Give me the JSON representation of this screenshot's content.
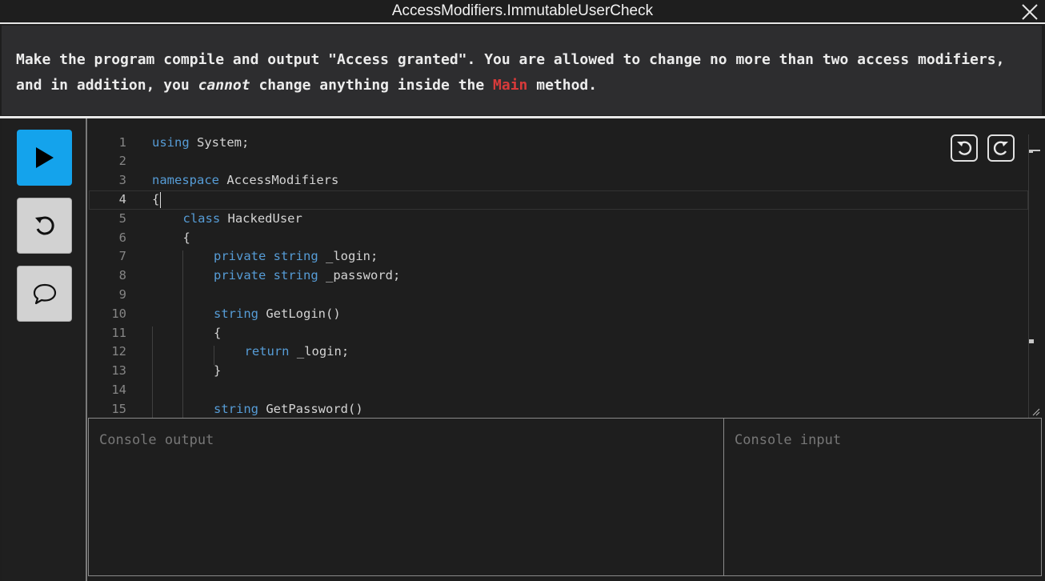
{
  "window": {
    "title": "AccessModifiers.ImmutableUserCheck"
  },
  "task": {
    "part1": "Make the program compile and output \"Access granted\". You are allowed to change no more than two access modifiers, and in addition, you ",
    "emphasis": "cannot",
    "part2": " change anything inside the ",
    "keyword": "Main",
    "part3": " method."
  },
  "sidebar": {
    "run_icon": "play-icon",
    "reset_icon": "reset-icon",
    "chat_icon": "chat-bubble-icon"
  },
  "editor": {
    "current_line": 4,
    "lines": [
      {
        "n": "1",
        "indent": 0,
        "tokens": [
          {
            "t": "using",
            "k": true
          },
          {
            "t": " System;"
          }
        ]
      },
      {
        "n": "2",
        "indent": 0,
        "tokens": []
      },
      {
        "n": "3",
        "indent": 0,
        "tokens": [
          {
            "t": "namespace",
            "k": true
          },
          {
            "t": " AccessModifiers"
          }
        ]
      },
      {
        "n": "4",
        "indent": 0,
        "tokens": [
          {
            "t": "{"
          }
        ]
      },
      {
        "n": "5",
        "indent": 1,
        "tokens": [
          {
            "t": "class",
            "k": true
          },
          {
            "t": " HackedUser"
          }
        ]
      },
      {
        "n": "6",
        "indent": 1,
        "tokens": [
          {
            "t": "{"
          }
        ]
      },
      {
        "n": "7",
        "indent": 2,
        "tokens": [
          {
            "t": "private",
            "k": true
          },
          {
            "t": " "
          },
          {
            "t": "string",
            "k": true
          },
          {
            "t": " _login;"
          }
        ]
      },
      {
        "n": "8",
        "indent": 2,
        "tokens": [
          {
            "t": "private",
            "k": true
          },
          {
            "t": " "
          },
          {
            "t": "string",
            "k": true
          },
          {
            "t": " _password;"
          }
        ]
      },
      {
        "n": "9",
        "indent": 0,
        "tokens": []
      },
      {
        "n": "10",
        "indent": 2,
        "tokens": [
          {
            "t": "string",
            "k": true
          },
          {
            "t": " GetLogin()"
          }
        ]
      },
      {
        "n": "11",
        "indent": 2,
        "tokens": [
          {
            "t": "{"
          }
        ]
      },
      {
        "n": "12",
        "indent": 3,
        "tokens": [
          {
            "t": "return",
            "k": true
          },
          {
            "t": " _login;"
          }
        ]
      },
      {
        "n": "13",
        "indent": 2,
        "tokens": [
          {
            "t": "}"
          }
        ]
      },
      {
        "n": "14",
        "indent": 0,
        "tokens": []
      },
      {
        "n": "15",
        "indent": 2,
        "tokens": [
          {
            "t": "string",
            "k": true
          },
          {
            "t": " GetPassword()"
          }
        ]
      }
    ],
    "undo_icon": "undo-icon",
    "redo_icon": "redo-icon"
  },
  "console": {
    "output_placeholder": "Console output",
    "input_placeholder": "Console input"
  },
  "colors": {
    "accent": "#14a3ec",
    "keyword": "#569cd6",
    "highlight": "#d83a3a"
  }
}
